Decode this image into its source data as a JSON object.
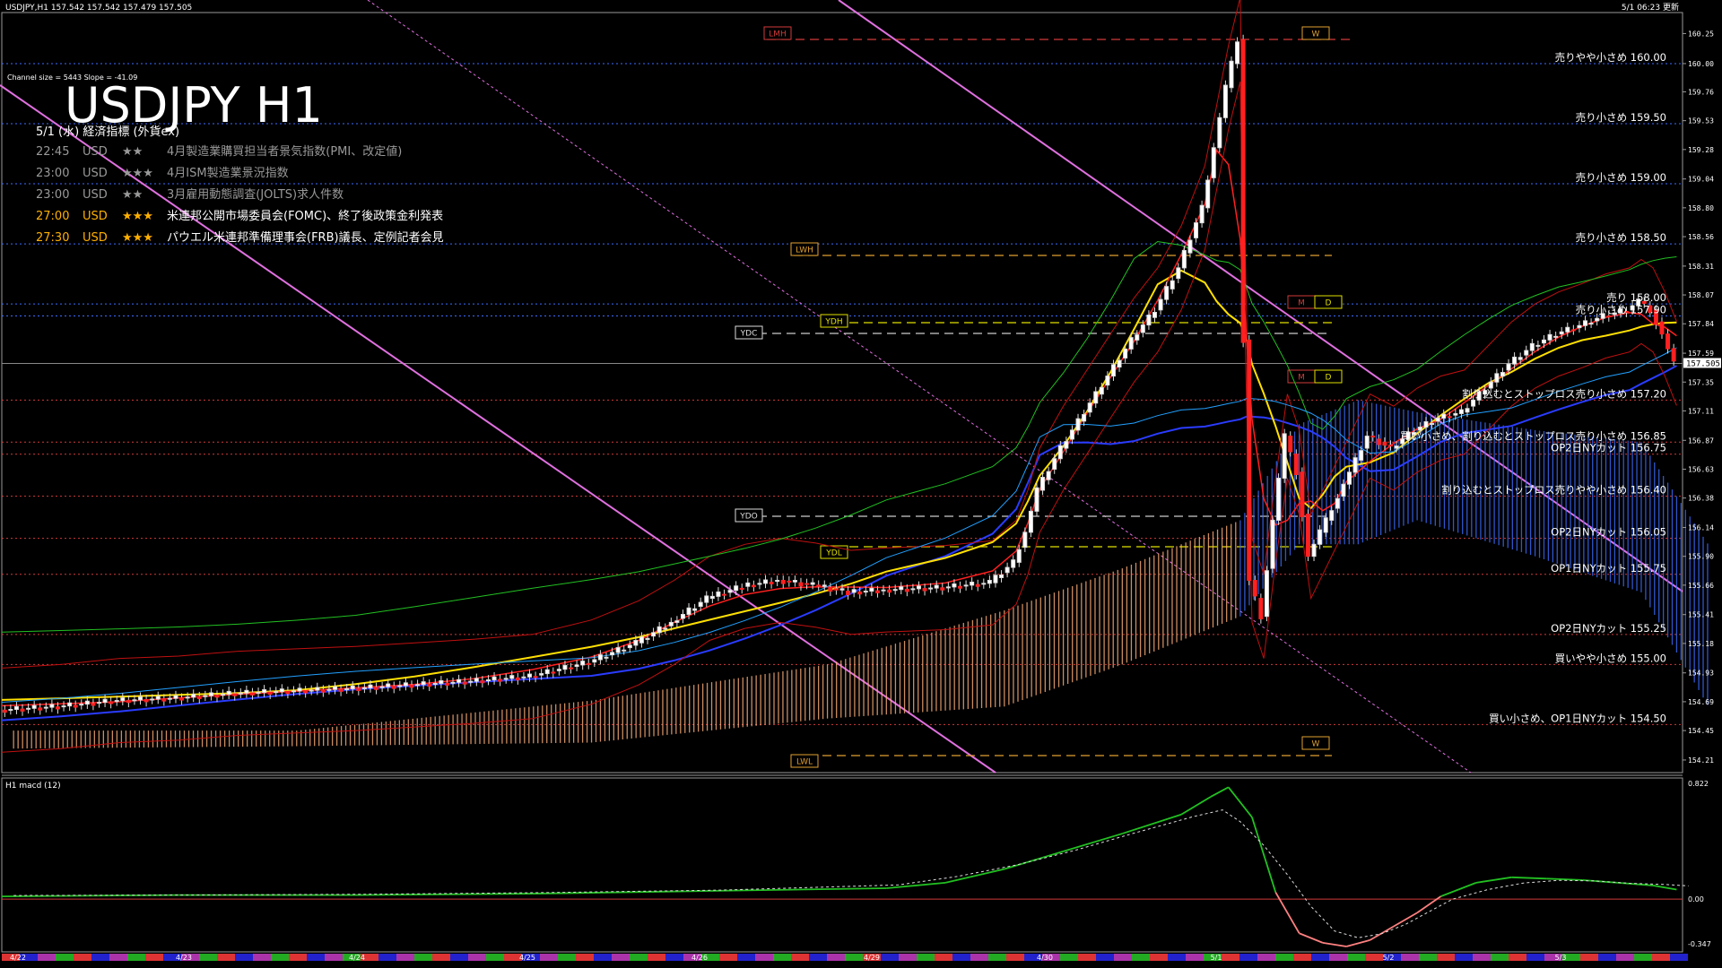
{
  "header": {
    "symbol_line": "USDJPY,H1  157.542 157.542 157.479 157.505",
    "datetime_update": "5/1 06:23 更新",
    "channel_info": "Channel size = 5443 Slope = -41.09",
    "big_title": "USDJPY H1"
  },
  "events": {
    "heading": "5/1 (水) 経済指標 (外貨ex)",
    "items": [
      {
        "time": "22:45",
        "cur": "USD",
        "stars": "★★",
        "name": "4月製造業購買担当者景気指数(PMI、改定値)",
        "status": "past"
      },
      {
        "time": "23:00",
        "cur": "USD",
        "stars": "★★★",
        "name": "4月ISM製造業景況指数",
        "status": "past"
      },
      {
        "time": "23:00",
        "cur": "USD",
        "stars": "★★",
        "name": "3月雇用動態調査(JOLTS)求人件数",
        "status": "past"
      },
      {
        "time": "27:00",
        "cur": "USD",
        "stars": "★★★",
        "name": "米連邦公開市場委員会(FOMC)、終了後政策金利発表",
        "status": "upcoming"
      },
      {
        "time": "27:30",
        "cur": "USD",
        "stars": "★★★",
        "name": "パウエル米連邦準備理事会(FRB)議長、定例記者会見",
        "status": "upcoming"
      }
    ]
  },
  "levels": [
    {
      "price": 160.0,
      "label": "売りやや小さめ 160.00"
    },
    {
      "price": 159.5,
      "label": "売り小さめ 159.50"
    },
    {
      "price": 159.0,
      "label": "売り小さめ 159.00"
    },
    {
      "price": 158.5,
      "label": "売り小さめ 158.50"
    },
    {
      "price": 158.0,
      "label": "売り 158.00"
    },
    {
      "price": 157.9,
      "label": "売り小さめ 157.90"
    },
    {
      "price": 157.2,
      "label": "割り込むとストップロス売り小さめ 157.20"
    },
    {
      "price": 156.85,
      "label": "買い小さめ、割り込むとストップロス売り小さめ 156.85"
    },
    {
      "price": 156.75,
      "label": "OP2日NYカット 156.75"
    },
    {
      "price": 156.4,
      "label": "割り込むとストップロス売りやや小さめ 156.40"
    },
    {
      "price": 156.05,
      "label": "OP2日NYカット 156.05"
    },
    {
      "price": 155.75,
      "label": "OP1日NYカット 155.75"
    },
    {
      "price": 155.25,
      "label": "OP2日NYカット 155.25"
    },
    {
      "price": 155.0,
      "label": "買いやや小さめ 155.00"
    },
    {
      "price": 154.5,
      "label": "買い小さめ、OP1日NYカット 154.50"
    }
  ],
  "markers": {
    "lmh": "LMH",
    "lwh": "LWH",
    "lwl": "LWL",
    "ydh": "YDH",
    "ydc": "YDC",
    "ydo": "YDO",
    "ydl": "YDL",
    "w": "W",
    "m": "M",
    "d": "D"
  },
  "current_price": "157.505",
  "macd": {
    "label": "H1  macd (12)",
    "max_label": "0.822",
    "zero_label": "0.00",
    "min_label": "-0.347"
  },
  "chart_data": {
    "type": "line",
    "title": "USDJPY H1",
    "price_axis": {
      "ylim": [
        154.13,
        160.38
      ],
      "ticks": [
        160.25,
        160.0,
        159.765,
        159.525,
        159.285,
        159.04,
        158.8,
        158.56,
        158.315,
        158.075,
        157.835,
        157.59,
        157.35,
        157.11,
        156.865,
        156.625,
        156.385,
        156.14,
        155.9,
        155.66,
        155.415,
        155.175,
        154.93,
        154.69,
        154.45,
        154.205
      ]
    },
    "x_ticks": [
      "4/22",
      "4/23",
      "4/24",
      "4/25",
      "4/26",
      "4/29",
      "4/30",
      "5/1",
      "5/2",
      "5/3"
    ],
    "close_path": [
      [
        0,
        154.62
      ],
      [
        10,
        154.65
      ],
      [
        20,
        154.7
      ],
      [
        30,
        154.72
      ],
      [
        40,
        154.76
      ],
      [
        50,
        154.78
      ],
      [
        60,
        154.8
      ],
      [
        70,
        154.83
      ],
      [
        80,
        154.86
      ],
      [
        90,
        154.9
      ],
      [
        100,
        155.02
      ],
      [
        108,
        155.18
      ],
      [
        114,
        155.35
      ],
      [
        120,
        155.55
      ],
      [
        126,
        155.65
      ],
      [
        132,
        155.7
      ],
      [
        138,
        155.66
      ],
      [
        144,
        155.6
      ],
      [
        150,
        155.62
      ],
      [
        160,
        155.64
      ],
      [
        168,
        155.68
      ],
      [
        172,
        155.85
      ],
      [
        174,
        156.1
      ],
      [
        176,
        156.45
      ],
      [
        180,
        156.8
      ],
      [
        184,
        157.1
      ],
      [
        188,
        157.4
      ],
      [
        192,
        157.7
      ],
      [
        196,
        157.95
      ],
      [
        200,
        158.3
      ],
      [
        204,
        158.8
      ],
      [
        206,
        159.3
      ],
      [
        208,
        159.8
      ],
      [
        210,
        160.2
      ],
      [
        211,
        157.7
      ],
      [
        212,
        155.7
      ],
      [
        214,
        155.4
      ],
      [
        216,
        156.2
      ],
      [
        218,
        156.9
      ],
      [
        220,
        156.6
      ],
      [
        222,
        155.9
      ],
      [
        224,
        156.1
      ],
      [
        226,
        156.3
      ],
      [
        228,
        156.5
      ],
      [
        232,
        156.9
      ],
      [
        236,
        156.8
      ],
      [
        240,
        156.95
      ],
      [
        244,
        157.05
      ],
      [
        248,
        157.1
      ],
      [
        252,
        157.3
      ],
      [
        256,
        157.5
      ],
      [
        260,
        157.65
      ],
      [
        264,
        157.75
      ],
      [
        268,
        157.82
      ],
      [
        272,
        157.9
      ],
      [
        276,
        157.95
      ],
      [
        278,
        158.02
      ],
      [
        280,
        157.95
      ],
      [
        282,
        157.75
      ],
      [
        284,
        157.505
      ]
    ],
    "ichimoku_cloud_visible": true,
    "grid": false,
    "macd_series": [
      [
        0,
        0.02
      ],
      [
        30,
        0.03
      ],
      [
        60,
        0.03
      ],
      [
        90,
        0.04
      ],
      [
        120,
        0.06
      ],
      [
        150,
        0.08
      ],
      [
        160,
        0.12
      ],
      [
        170,
        0.22
      ],
      [
        180,
        0.35
      ],
      [
        190,
        0.48
      ],
      [
        200,
        0.62
      ],
      [
        205,
        0.75
      ],
      [
        208,
        0.82
      ],
      [
        212,
        0.6
      ],
      [
        216,
        0.05
      ],
      [
        220,
        -0.25
      ],
      [
        224,
        -0.32
      ],
      [
        228,
        -0.347
      ],
      [
        232,
        -0.3
      ],
      [
        236,
        -0.2
      ],
      [
        240,
        -0.1
      ],
      [
        244,
        0.02
      ],
      [
        250,
        0.12
      ],
      [
        256,
        0.16
      ],
      [
        262,
        0.15
      ],
      [
        268,
        0.14
      ],
      [
        274,
        0.12
      ],
      [
        280,
        0.1
      ],
      [
        284,
        0.07
      ]
    ]
  }
}
